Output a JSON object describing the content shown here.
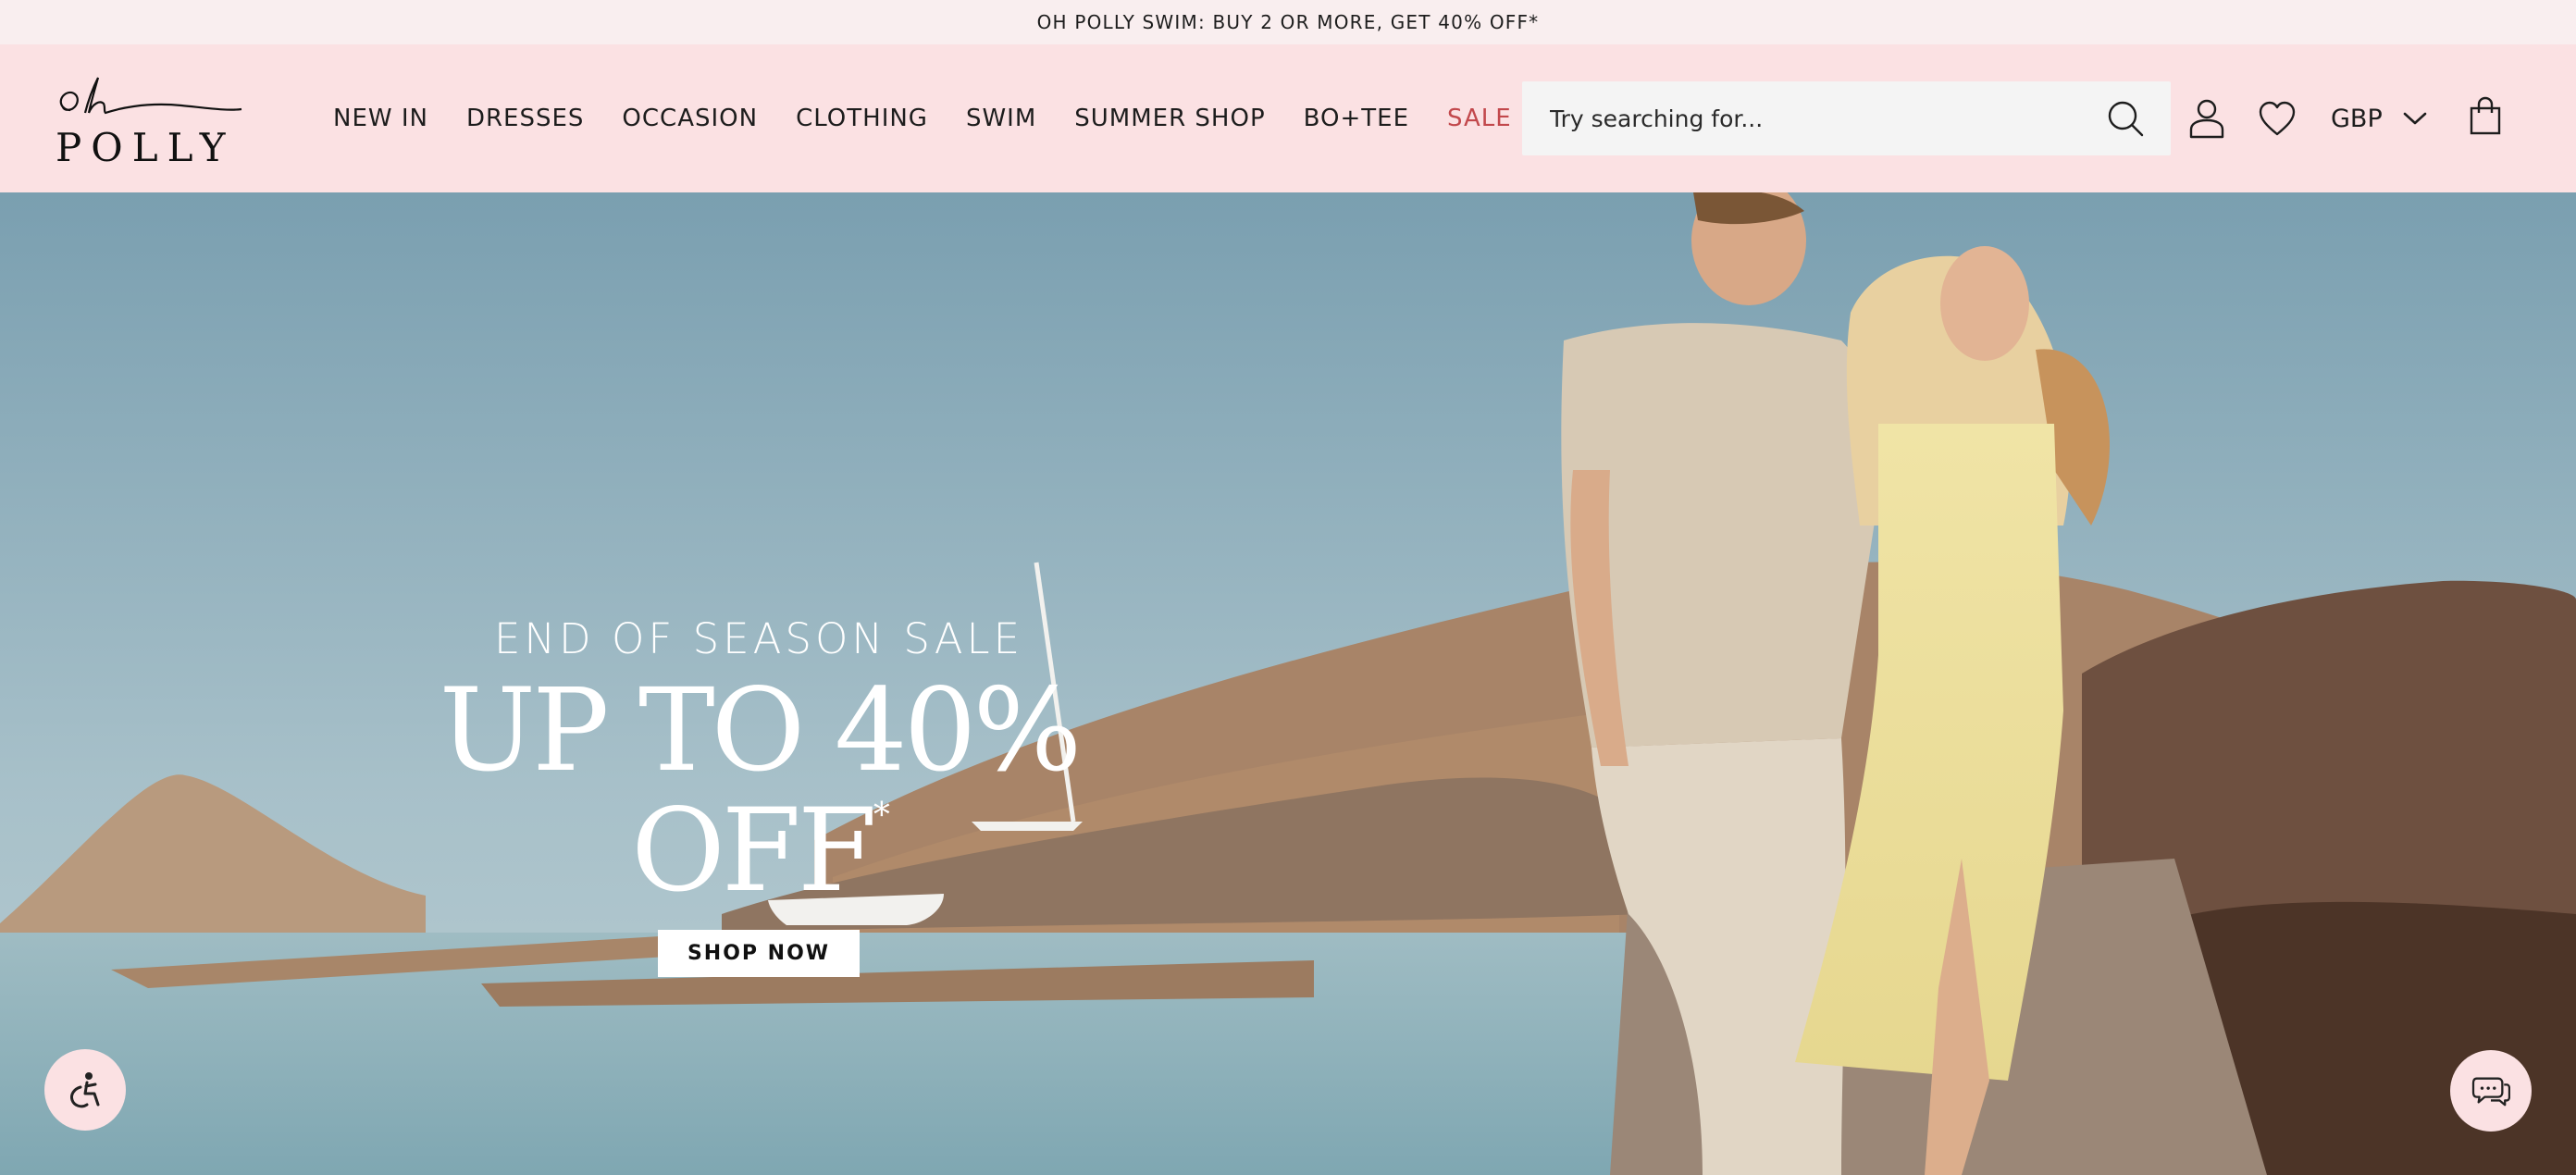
{
  "announcement": {
    "text": "OH POLLY SWIM: BUY 2 OR MORE, GET 40% OFF*"
  },
  "logo": {
    "text_top": "oh",
    "text_bottom": "POLLY"
  },
  "nav": {
    "items": [
      {
        "label": "NEW IN"
      },
      {
        "label": "DRESSES"
      },
      {
        "label": "OCCASION"
      },
      {
        "label": "CLOTHING"
      },
      {
        "label": "SWIM"
      },
      {
        "label": "SUMMER SHOP"
      },
      {
        "label": "BO+TEE"
      },
      {
        "label": "SALE"
      }
    ]
  },
  "search": {
    "placeholder": "Try searching for...",
    "value": "",
    "icon": "search-icon"
  },
  "header_actions": {
    "account_icon": "user-icon",
    "wishlist_icon": "heart-icon",
    "currency": "GBP",
    "bag_icon": "shopping-bag-icon"
  },
  "hero": {
    "kicker": "END OF SEASON SALE",
    "headline": "UP TO 40% OFF",
    "headline_mark": "*",
    "cta": "SHOP NOW"
  },
  "floating": {
    "accessibility_icon": "accessibility-icon",
    "chat_icon": "chat-icon"
  },
  "colors": {
    "announcement_bg": "#f9eeef",
    "header_bg": "#fbe1e3",
    "sale_red": "#c2484c",
    "text": "#1d1d1d"
  }
}
